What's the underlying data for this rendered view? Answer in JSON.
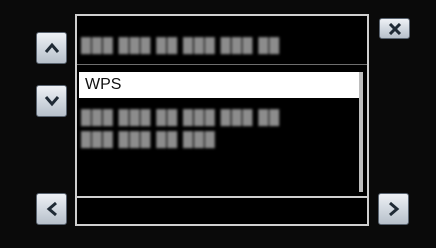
{
  "list": {
    "items": [
      {
        "label": "███ ███ ██ ███ ███ ██",
        "blurred": true
      },
      {
        "label": "WPS",
        "selected": true
      },
      {
        "label": "███ ███ ██ ███ ███ ██",
        "blurred": true
      },
      {
        "label": "███ ███ ██ ███",
        "blurred": true
      }
    ]
  },
  "buttons": {
    "up": "chevron-up-icon",
    "down": "chevron-down-icon",
    "left": "chevron-left-icon",
    "right": "chevron-right-icon",
    "close": "close-icon"
  },
  "colors": {
    "background": "#0b0b0b",
    "button_face": "#cfd6de",
    "icon": "#1f2a35",
    "selected_bg": "#ffffff",
    "border": "#cfcfcf"
  }
}
